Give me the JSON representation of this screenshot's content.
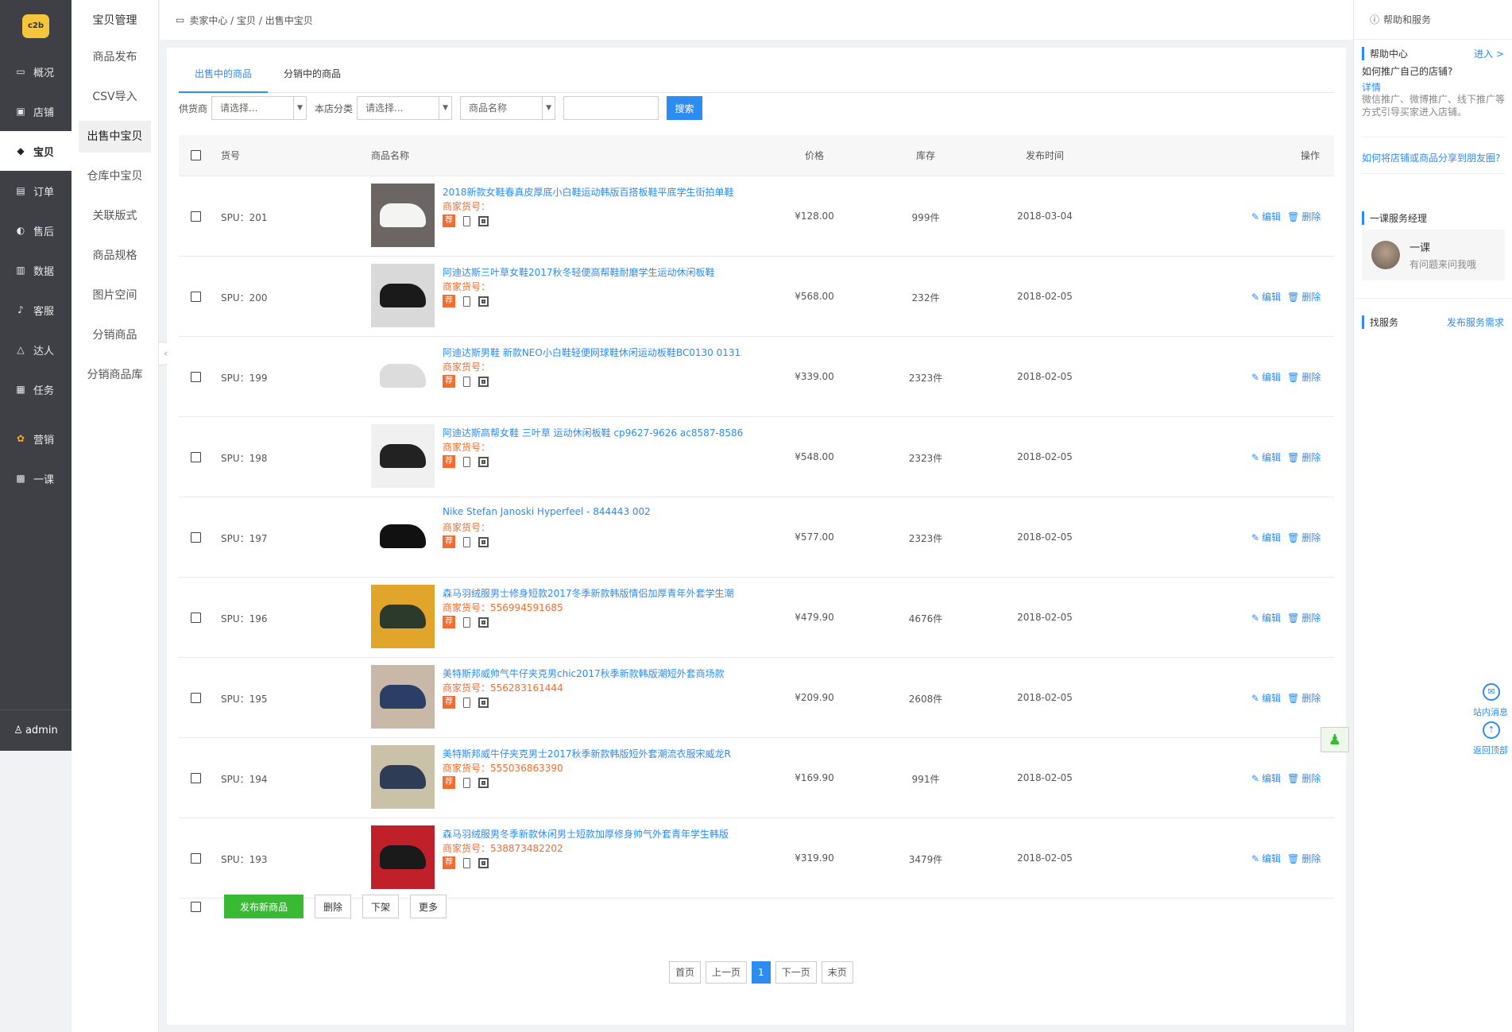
{
  "nav": {
    "logo_text": "c2b",
    "items": [
      {
        "icon": "monitor-icon",
        "glyph": "🖳",
        "label": "概况"
      },
      {
        "icon": "shop-icon",
        "glyph": "▣",
        "label": "店铺"
      },
      {
        "icon": "tag-icon",
        "glyph": "◆",
        "label": "宝贝"
      },
      {
        "icon": "order-icon",
        "glyph": "▤",
        "label": "订单"
      },
      {
        "icon": "headset-icon",
        "glyph": "◐",
        "label": "售后"
      },
      {
        "icon": "chart-icon",
        "glyph": "▥",
        "label": "数据"
      },
      {
        "icon": "bell-icon",
        "glyph": "♫",
        "label": "客服"
      },
      {
        "icon": "triangle-icon",
        "glyph": "△",
        "label": "达人"
      },
      {
        "icon": "task-icon",
        "glyph": "▦",
        "label": "任务"
      },
      {
        "icon": "flower-icon",
        "glyph": "✿",
        "label": "营销"
      },
      {
        "icon": "lesson-icon",
        "glyph": "▩",
        "label": "一课"
      }
    ],
    "user": "admin"
  },
  "subnav": {
    "title": "宝贝管理",
    "items": [
      "商品发布",
      "CSV导入",
      "出售中宝贝",
      "仓库中宝贝",
      "关联版式",
      "商品规格",
      "图片空间",
      "分销商品",
      "分销商品库"
    ]
  },
  "breadcrumb": "卖家中心 / 宝贝 / 出售中宝贝",
  "tabs": [
    "出售中的商品",
    "分销中的商品"
  ],
  "filters": {
    "supplier_label": "供货商",
    "supplier_value": "请选择...",
    "category_label": "本店分类",
    "category_value": "请选择...",
    "field_value": "商品名称",
    "keyword_value": "",
    "search_label": "搜索"
  },
  "columns": {
    "sku": "货号",
    "name": "商品名称",
    "price": "价格",
    "stock": "库存",
    "date": "发布时间",
    "ops": "操作"
  },
  "code_label": "商家货号：",
  "recommend_tag": "荐",
  "edit_label": "编辑",
  "delete_label": "删除",
  "rows": [
    {
      "spu": "SPU：201",
      "name": "2018新款女鞋春真皮厚底小白鞋运动韩版百搭板鞋平底学生街拍单鞋",
      "code": "",
      "price": "¥128.00",
      "stock": "999件",
      "date": "2018-03-04",
      "img_bg": "#6b6663",
      "img_fg": "#f4f4f2"
    },
    {
      "spu": "SPU：200",
      "name": "阿迪达斯三叶草女鞋2017秋冬轻便高帮鞋耐磨学生运动休闲板鞋",
      "code": "",
      "price": "¥568.00",
      "stock": "232件",
      "date": "2018-02-05",
      "img_bg": "#d9d9d9",
      "img_fg": "#1a1a1a"
    },
    {
      "spu": "SPU：199",
      "name": "阿迪达斯男鞋 新款NEO小白鞋轻便网球鞋休闲运动板鞋BC0130 0131",
      "code": "",
      "price": "¥339.00",
      "stock": "2323件",
      "date": "2018-02-05",
      "img_bg": "#ffffff",
      "img_fg": "#dcdcdc"
    },
    {
      "spu": "SPU：198",
      "name": "阿迪达斯高帮女鞋 三叶草 运动休闲板鞋 cp9627-9626 ac8587-8586",
      "code": "",
      "price": "¥548.00",
      "stock": "2323件",
      "date": "2018-02-05",
      "img_bg": "#f0f0f0",
      "img_fg": "#222222"
    },
    {
      "spu": "SPU：197",
      "name": "Nike Stefan Janoski Hyperfeel - 844443 002",
      "code": "",
      "price": "¥577.00",
      "stock": "2323件",
      "date": "2018-02-05",
      "img_bg": "#ffffff",
      "img_fg": "#111111"
    },
    {
      "spu": "SPU：196",
      "name": "森马羽绒服男士修身短款2017冬季新款韩版情侣加厚青年外套学生潮",
      "code": "556994591685",
      "price": "¥479.90",
      "stock": "4676件",
      "date": "2018-02-05",
      "img_bg": "#e0a52a",
      "img_fg": "#2b3a2a"
    },
    {
      "spu": "SPU：195",
      "name": "美特斯邦威帅气牛仔夹克男chic2017秋季新款韩版潮短外套商场款",
      "code": "556283161444",
      "price": "¥209.90",
      "stock": "2608件",
      "date": "2018-02-05",
      "img_bg": "#c8b8a8",
      "img_fg": "#2c3e66"
    },
    {
      "spu": "SPU：194",
      "name": "美特斯邦威牛仔夹克男士2017秋季新款韩版短外套潮流衣服宋威龙R",
      "code": "555036863390",
      "price": "¥169.90",
      "stock": "991件",
      "date": "2018-02-05",
      "img_bg": "#c9c2a8",
      "img_fg": "#2f3c55"
    },
    {
      "spu": "SPU：193",
      "name": "森马羽绒服男冬季新款休闲男士短款加厚修身帅气外套青年学生韩版",
      "code": "538873482202",
      "price": "¥319.90",
      "stock": "3479件",
      "date": "2018-02-05",
      "img_bg": "#c0202a",
      "img_fg": "#1a1a1a"
    }
  ],
  "actions": {
    "publish": "发布新商品",
    "delete": "删除",
    "offshelf": "下架",
    "more": "更多"
  },
  "pagination": {
    "first": "首页",
    "prev": "上一页",
    "current": "1",
    "next": "下一页",
    "last": "末页"
  },
  "right_panel": {
    "header": "帮助和服务",
    "help_title": "帮助中心",
    "help_enter": "进入 >",
    "question": "如何推广自己的店铺?",
    "detail": "详情",
    "desc": "微信推广、微博推广、线下推广等方式引导买家进入店铺。",
    "share_link": "如何将店铺或商品分享到朋友圈?",
    "manager_title": "一课服务经理",
    "manager_name": "一课",
    "manager_msg": "有问题来问我哦",
    "find_title": "找服务",
    "find_link": "发布服务需求",
    "msg": "站内消息",
    "top": "返回顶部"
  },
  "colors": {
    "accent": "#2d8cf0",
    "orange": "#f56c2d",
    "green": "#3ab934",
    "nav_bg": "#3f4045"
  }
}
